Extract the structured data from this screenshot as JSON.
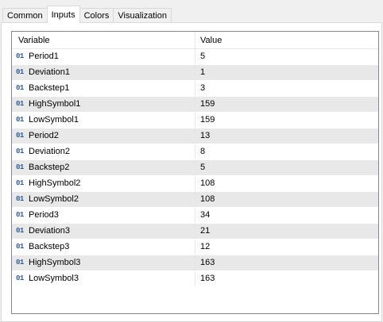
{
  "tabs": [
    {
      "label": "Common",
      "active": false
    },
    {
      "label": "Inputs",
      "active": true
    },
    {
      "label": "Colors",
      "active": false
    },
    {
      "label": "Visualization",
      "active": false
    }
  ],
  "table": {
    "columns": [
      "Variable",
      "Value"
    ],
    "type_icon": "01",
    "rows": [
      {
        "variable": "Period1",
        "value": "5"
      },
      {
        "variable": "Deviation1",
        "value": "1"
      },
      {
        "variable": "Backstep1",
        "value": "3"
      },
      {
        "variable": "HighSymbol1",
        "value": "159"
      },
      {
        "variable": "LowSymbol1",
        "value": "159"
      },
      {
        "variable": "Period2",
        "value": "13"
      },
      {
        "variable": "Deviation2",
        "value": "8"
      },
      {
        "variable": "Backstep2",
        "value": "5"
      },
      {
        "variable": "HighSymbol2",
        "value": "108"
      },
      {
        "variable": "LowSymbol2",
        "value": "108"
      },
      {
        "variable": "Period3",
        "value": "34"
      },
      {
        "variable": "Deviation3",
        "value": "21"
      },
      {
        "variable": "Backstep3",
        "value": "12"
      },
      {
        "variable": "HighSymbol3",
        "value": "163"
      },
      {
        "variable": "LowSymbol3",
        "value": "163"
      }
    ]
  },
  "colors": {
    "row_alt": "#e8e8e8",
    "icon": "#2b5ea8"
  }
}
